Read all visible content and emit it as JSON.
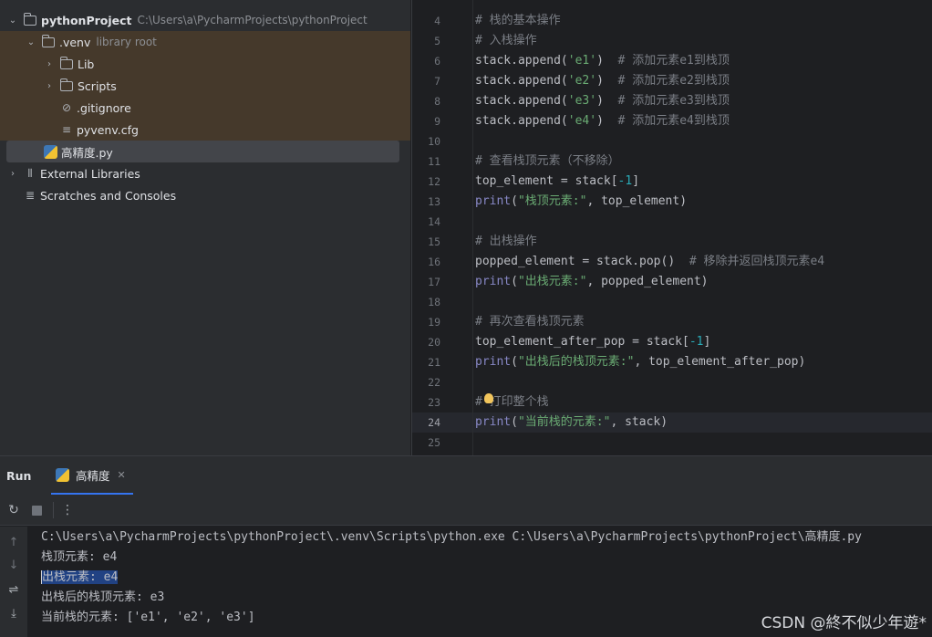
{
  "project_tree": {
    "root": {
      "name": "pythonProject",
      "path": "C:\\Users\\a\\PycharmProjects\\pythonProject"
    },
    "venv": {
      "name": ".venv",
      "hint": "library root"
    },
    "venv_children": [
      "Lib",
      "Scripts",
      ".gitignore",
      "pyvenv.cfg"
    ],
    "file": "高精度.py",
    "external_libraries": "External Libraries",
    "scratches": "Scratches and Consoles"
  },
  "editor": {
    "line_numbers": [
      "4",
      "5",
      "6",
      "7",
      "8",
      "9",
      "10",
      "11",
      "12",
      "13",
      "14",
      "15",
      "16",
      "17",
      "18",
      "19",
      "20",
      "21",
      "22",
      "23",
      "24",
      "25"
    ],
    "current_line": "24",
    "lines": [
      [
        {
          "t": "# 栈的基本操作",
          "c": "cm"
        }
      ],
      [
        {
          "t": "# 入栈操作",
          "c": "cm"
        }
      ],
      [
        {
          "t": "stack.append(",
          "c": ""
        },
        {
          "t": "'e1'",
          "c": "str"
        },
        {
          "t": ")  ",
          "c": ""
        },
        {
          "t": "# 添加元素e1到栈顶",
          "c": "cm"
        }
      ],
      [
        {
          "t": "stack.append(",
          "c": ""
        },
        {
          "t": "'e2'",
          "c": "str"
        },
        {
          "t": ")  ",
          "c": ""
        },
        {
          "t": "# 添加元素e2到栈顶",
          "c": "cm"
        }
      ],
      [
        {
          "t": "stack.append(",
          "c": ""
        },
        {
          "t": "'e3'",
          "c": "str"
        },
        {
          "t": ")  ",
          "c": ""
        },
        {
          "t": "# 添加元素e3到栈顶",
          "c": "cm"
        }
      ],
      [
        {
          "t": "stack.append(",
          "c": ""
        },
        {
          "t": "'e4'",
          "c": "str"
        },
        {
          "t": ")  ",
          "c": ""
        },
        {
          "t": "# 添加元素e4到栈顶",
          "c": "cm"
        }
      ],
      [],
      [
        {
          "t": "# 查看栈顶元素（不移除）",
          "c": "cm"
        }
      ],
      [
        {
          "t": "top_element = stack[",
          "c": ""
        },
        {
          "t": "-1",
          "c": "num"
        },
        {
          "t": "]",
          "c": ""
        }
      ],
      [
        {
          "t": "print",
          "c": "fn"
        },
        {
          "t": "(",
          "c": ""
        },
        {
          "t": "\"栈顶元素:\"",
          "c": "str"
        },
        {
          "t": ", top_element)",
          "c": ""
        }
      ],
      [],
      [
        {
          "t": "# 出栈操作",
          "c": "cm"
        }
      ],
      [
        {
          "t": "popped_element = stack.pop()  ",
          "c": ""
        },
        {
          "t": "# 移除并返回栈顶元素e4",
          "c": "cm"
        }
      ],
      [
        {
          "t": "print",
          "c": "fn"
        },
        {
          "t": "(",
          "c": ""
        },
        {
          "t": "\"出栈元素:\"",
          "c": "str"
        },
        {
          "t": ", popped_element)",
          "c": ""
        }
      ],
      [],
      [
        {
          "t": "# 再次查看栈顶元素",
          "c": "cm"
        }
      ],
      [
        {
          "t": "top_element_after_pop = stack[",
          "c": ""
        },
        {
          "t": "-1",
          "c": "num"
        },
        {
          "t": "]",
          "c": ""
        }
      ],
      [
        {
          "t": "print",
          "c": "fn"
        },
        {
          "t": "(",
          "c": ""
        },
        {
          "t": "\"出栈后的栈顶元素:\"",
          "c": "str"
        },
        {
          "t": ", top_element_after_pop)",
          "c": ""
        }
      ],
      [],
      [
        {
          "t": "# 打印整个栈",
          "c": "cm"
        }
      ],
      [
        {
          "t": "print",
          "c": "fn"
        },
        {
          "t": "(",
          "c": ""
        },
        {
          "t": "\"当前栈的元素:\"",
          "c": "str"
        },
        {
          "t": ", stack)",
          "c": ""
        }
      ],
      []
    ]
  },
  "run": {
    "title": "Run",
    "tab_label": "高精度",
    "console": [
      "C:\\Users\\a\\PycharmProjects\\pythonProject\\.venv\\Scripts\\python.exe C:\\Users\\a\\PycharmProjects\\pythonProject\\高精度.py",
      "栈顶元素: e4",
      "出栈元素: e4",
      "出栈后的栈顶元素: e3",
      "当前栈的元素: ['e1', 'e2', 'e3']"
    ],
    "selected_console_line": 2
  },
  "watermark": "CSDN @終不似少年遊*",
  "icons": {
    "rerun": "rerun-icon",
    "stop": "stop-icon",
    "more": "more-vertical-icon",
    "up": "arrow-up-icon",
    "down": "arrow-down-icon",
    "wrap": "soft-wrap-icon",
    "scroll_end": "scroll-to-end-icon"
  },
  "colors": {
    "accent": "#3574f0",
    "selection": "#214283",
    "venv_highlight": "#45392b",
    "comment": "#7a7e85",
    "string": "#6aab73",
    "number": "#2aacb8",
    "builtin": "#8888c6"
  }
}
